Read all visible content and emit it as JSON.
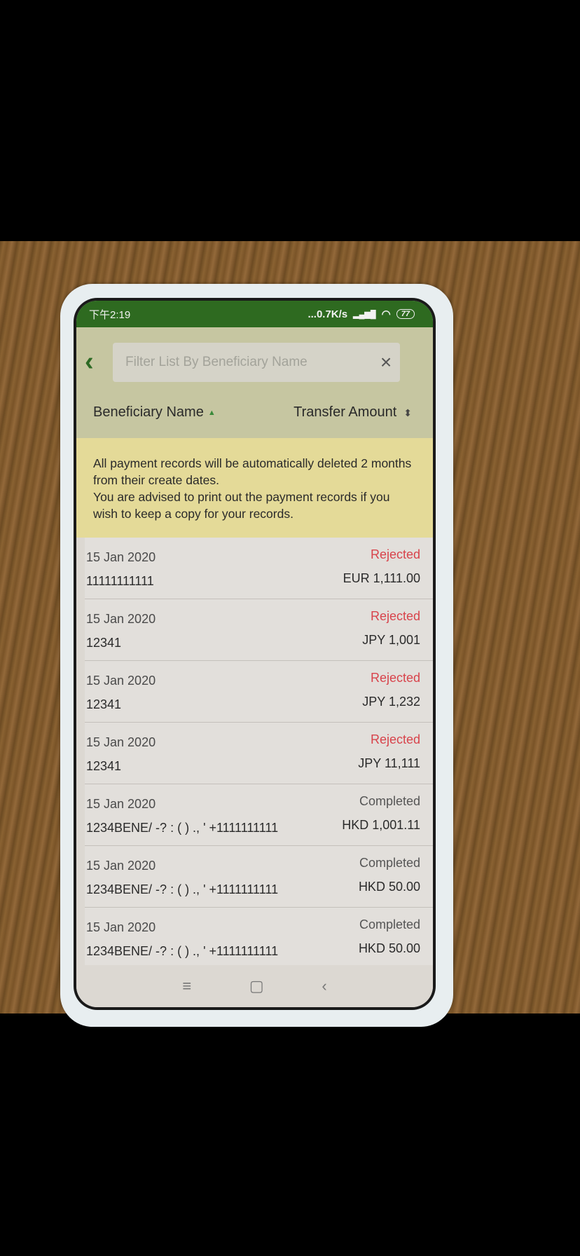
{
  "status_bar": {
    "time": "下午2:19",
    "network_speed": "...0.7K/s",
    "network": "4G",
    "battery": "77"
  },
  "header": {
    "search_placeholder": "Filter List By Beneficiary Name",
    "columns": [
      {
        "label": "Beneficiary Name",
        "sort": "ascending"
      },
      {
        "label": "Transfer Amount",
        "sort": "none"
      }
    ]
  },
  "notice": {
    "line1": "All payment records will be automatically deleted 2 months from their create dates.",
    "line2": "You are advised to print out the payment records if you wish to keep a copy for your records."
  },
  "colors": {
    "status_bar": "#2e6a20",
    "rejected": "#d8434b",
    "completed": "#555555",
    "notice_bg": "#e4da98",
    "accent": "#2d6a24"
  },
  "records": [
    {
      "date": "15 Jan 2020",
      "status": "Rejected",
      "beneficiary": "11111111111",
      "amount": "EUR 1,111.00"
    },
    {
      "date": "15 Jan 2020",
      "status": "Rejected",
      "beneficiary": "12341",
      "amount": "JPY 1,001"
    },
    {
      "date": "15 Jan 2020",
      "status": "Rejected",
      "beneficiary": "12341",
      "amount": "JPY 1,232"
    },
    {
      "date": "15 Jan 2020",
      "status": "Rejected",
      "beneficiary": "12341",
      "amount": "JPY 11,111"
    },
    {
      "date": "15 Jan 2020",
      "status": "Completed",
      "beneficiary": "1234BENE/ -? : ( ) ., ' +1111111111",
      "amount": "HKD 1,001.11"
    },
    {
      "date": "15 Jan 2020",
      "status": "Completed",
      "beneficiary": "1234BENE/ -? : ( ) ., ' +1111111111",
      "amount": "HKD 50.00"
    },
    {
      "date": "15 Jan 2020",
      "status": "Completed",
      "beneficiary": "1234BENE/ -? : ( ) ., ' +1111111111",
      "amount": "HKD 50.00"
    }
  ]
}
